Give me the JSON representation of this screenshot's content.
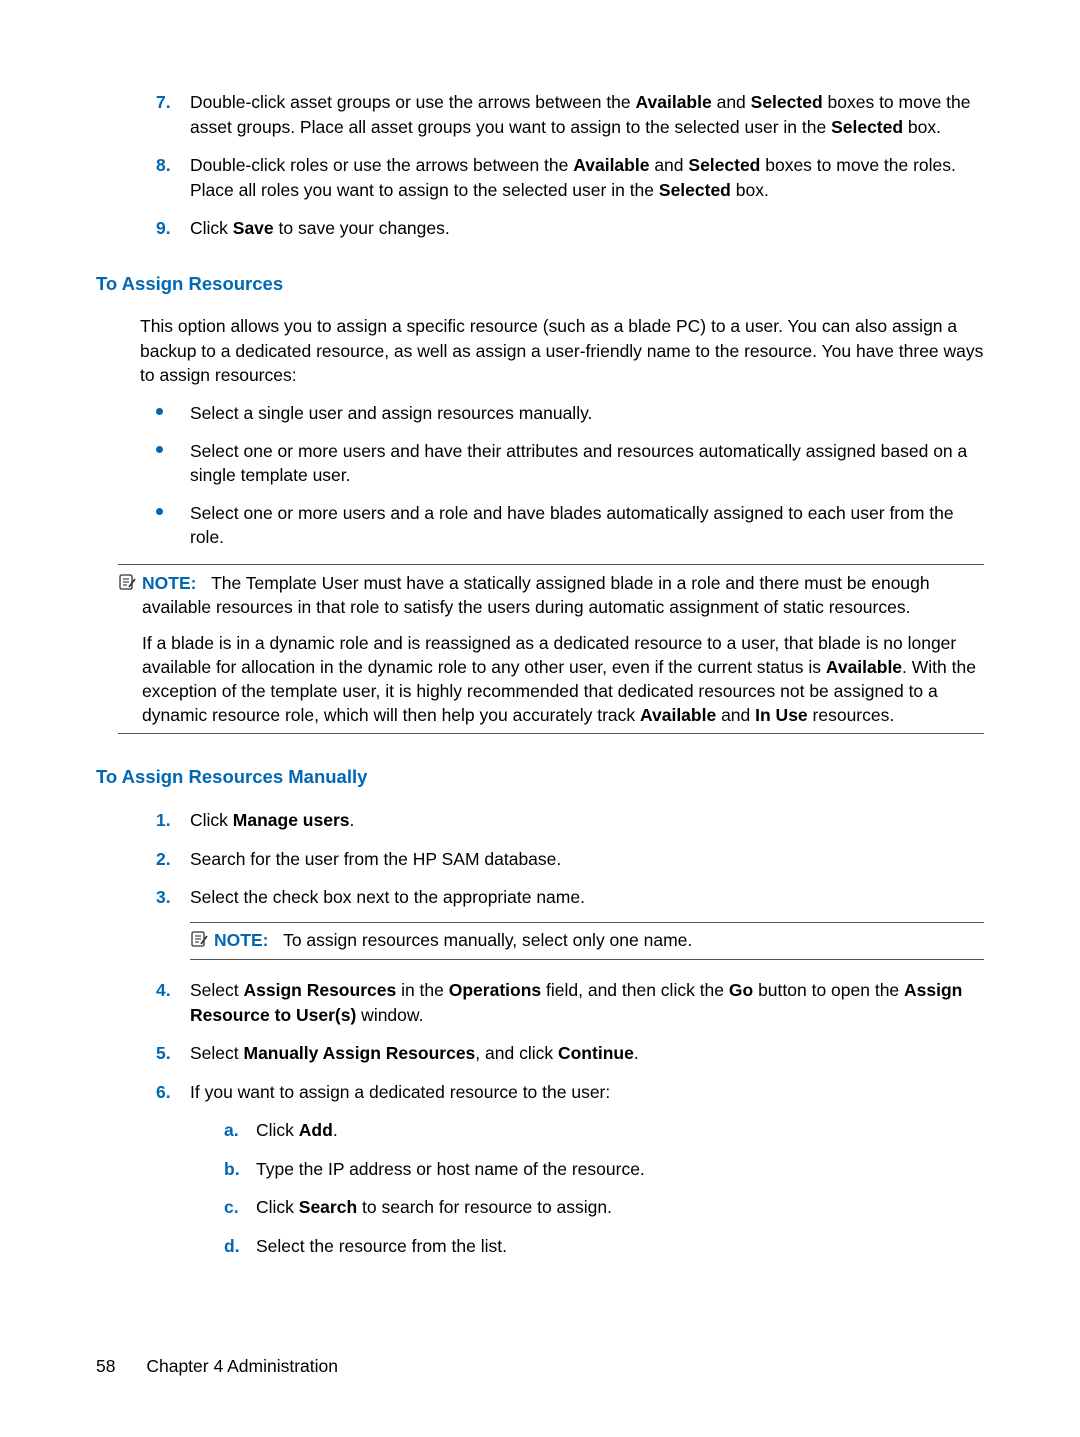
{
  "topList": [
    {
      "num": "7.",
      "html": "Double-click asset groups or use the arrows between the <b>Available</b> and <b>Selected</b> boxes to move the asset groups. Place all asset groups you want to assign to the selected user in the <b>Selected</b> box."
    },
    {
      "num": "8.",
      "html": "Double-click roles or use the arrows between the <b>Available</b> and <b>Selected</b> boxes to move the roles. Place all roles you want to assign to the selected user in the <b>Selected</b> box."
    },
    {
      "num": "9.",
      "html": "Click <b>Save</b> to save your changes."
    }
  ],
  "section1": {
    "heading": "To Assign Resources",
    "intro": "This option allows you to assign a specific resource (such as a blade PC) to a user. You can also assign a backup to a dedicated resource, as well as assign a user-friendly name to the resource. You have three ways to assign resources:",
    "bullets": [
      "Select a single user and assign resources manually.",
      "Select one or more users and have their attributes and resources automatically assigned based on a single template user.",
      "Select one or more users and a role and have blades automatically assigned to each user from the role."
    ],
    "noteLabel": "NOTE:",
    "noteText": "The Template User must have a statically assigned blade in a role and there must be enough available resources in that role to satisfy the users during automatic assignment of static resources.",
    "noteParaHtml": "If a blade is in a dynamic role and is reassigned as a dedicated resource to a user, that blade is no longer available for allocation in the dynamic role to any other user, even if the current status is <b>Available</b>. With the exception of the template user, it is highly recommended that dedicated resources not be assigned to a dynamic resource role, which will then help you accurately track <b>Available</b> and <b>In Use</b> resources."
  },
  "section2": {
    "heading": "To Assign Resources Manually",
    "steps": [
      {
        "num": "1.",
        "html": "Click <b>Manage users</b>."
      },
      {
        "num": "2.",
        "html": "Search for the user from the HP SAM database."
      },
      {
        "num": "3.",
        "html": "Select the check box next to the appropriate name.",
        "note": {
          "label": "NOTE:",
          "text": "To assign resources manually, select only one name."
        }
      },
      {
        "num": "4.",
        "html": "Select <b>Assign Resources</b> in the <b>Operations</b> field, and then click the <b>Go</b> button to open the <b>Assign Resource to User(s)</b> window."
      },
      {
        "num": "5.",
        "html": "Select <b>Manually Assign Resources</b>, and click <b>Continue</b>."
      },
      {
        "num": "6.",
        "html": "If you want to assign a dedicated resource to the user:",
        "sub": [
          {
            "m": "a.",
            "html": "Click <b>Add</b>."
          },
          {
            "m": "b.",
            "html": "Type the IP address or host name of the resource."
          },
          {
            "m": "c.",
            "html": "Click <b>Search</b> to search for resource to assign."
          },
          {
            "m": "d.",
            "html": "Select the resource from the list."
          }
        ]
      }
    ]
  },
  "footer": {
    "page": "58",
    "chapter": "Chapter 4   Administration"
  }
}
